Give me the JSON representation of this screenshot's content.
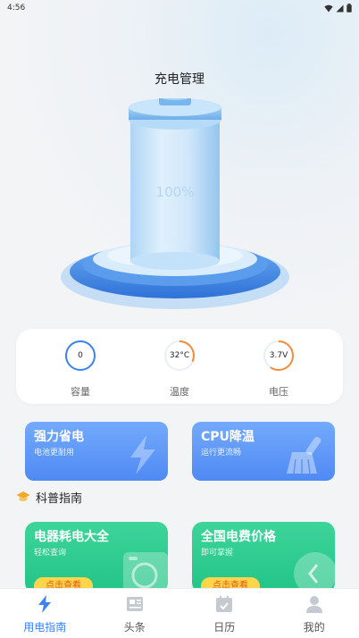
{
  "status_bar": {
    "time": "4:56"
  },
  "page_title": "充电管理",
  "battery": {
    "percent_text": "100%"
  },
  "stats": [
    {
      "value": "0",
      "label": "容量",
      "fraction": 0.0
    },
    {
      "value": "32°C",
      "label": "温度",
      "fraction": 0.32
    },
    {
      "value": "3.7V",
      "label": "电压",
      "fraction": 0.6
    }
  ],
  "features": [
    {
      "title": "强力省电",
      "subtitle": "电池更耐用",
      "icon": "lightning-icon"
    },
    {
      "title": "CPU降温",
      "subtitle": "运行更流畅",
      "icon": "broom-icon"
    }
  ],
  "section": {
    "title": "科普指南",
    "icon": "graduation-cap-icon"
  },
  "guides": [
    {
      "title": "电器耗电大全",
      "subtitle": "轻松查询",
      "button": "点击查看"
    },
    {
      "title": "全国电费价格",
      "subtitle": "即可掌握",
      "button": "点击查看"
    }
  ],
  "tabs": [
    {
      "label": "用电指南",
      "icon": "lightning-icon",
      "active": true
    },
    {
      "label": "头条",
      "icon": "newspaper-icon",
      "active": false
    },
    {
      "label": "日历",
      "icon": "calendar-icon",
      "active": false
    },
    {
      "label": "我的",
      "icon": "person-icon",
      "active": false
    }
  ],
  "colors": {
    "accent": "#3b82f6",
    "feature_blue": "#5b95f6",
    "guide_green": "#2cca8e",
    "button_yellow": "#ffd54a",
    "ring_orange": "#f28b3c",
    "ring_blue": "#3b82f6"
  }
}
